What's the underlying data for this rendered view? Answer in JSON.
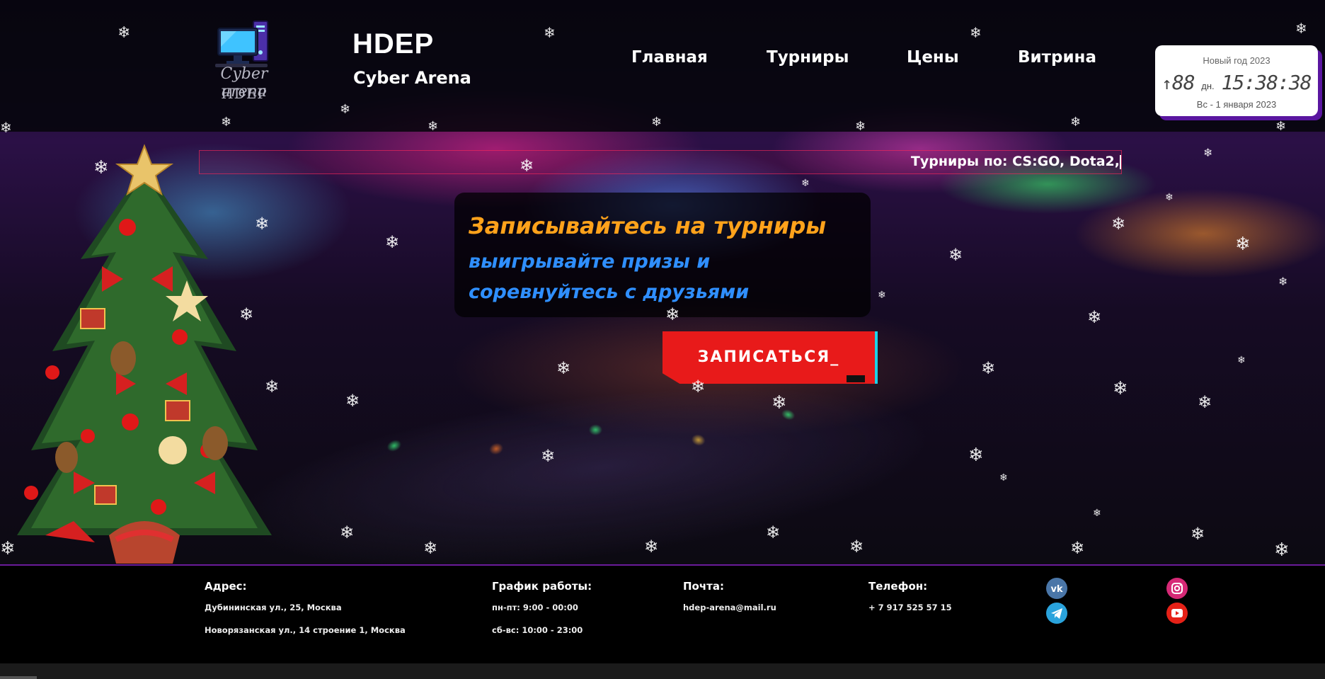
{
  "header": {
    "logo_line1": "Cyber arena",
    "logo_line2": "HDEP",
    "brand_title": "HDEP",
    "brand_subtitle": "Cyber Arena",
    "nav": [
      {
        "label": "Главная"
      },
      {
        "label": "Турниры"
      },
      {
        "label": "Цены"
      },
      {
        "label": "Витрина"
      }
    ]
  },
  "countdown": {
    "title": "Новый год 2023",
    "arrow": "↑",
    "days": "88",
    "days_unit": "дн.",
    "time": "15:38:38",
    "date": "Вс - 1 января 2023"
  },
  "ticker": {
    "text": "Турниры по: CS:GO, Dota2,"
  },
  "promo": {
    "line1": "Записывайтесь на турниры",
    "line2": "выигрывайте призы и соревнуйтесь с друзьями"
  },
  "cta": {
    "label": "ЗАПИСАТЬСЯ_"
  },
  "footer": {
    "address": {
      "heading": "Адрес:",
      "lines": [
        "Дубининская ул., 25, Москва",
        "Новорязанская ул., 14 строение 1, Москва"
      ]
    },
    "schedule": {
      "heading": "График работы:",
      "lines": [
        "пн-пт: 9:00 - 00:00",
        "сб-вс: 10:00 - 23:00"
      ]
    },
    "mail": {
      "heading": "Почта:",
      "value": "hdep-arena@mail.ru"
    },
    "phone": {
      "heading": "Телефон:",
      "value": "+ 7 917 525 57 15"
    },
    "socials": [
      {
        "icon": "vk-icon",
        "color": "#4a76a8"
      },
      {
        "icon": "telegram-icon",
        "color": "#2aa3dc"
      },
      {
        "icon": "instagram-icon",
        "color": "#d62976"
      },
      {
        "icon": "youtube-icon",
        "color": "#e62117"
      }
    ]
  },
  "colors": {
    "accent_orange": "#ffa21b",
    "accent_blue": "#2f8fff",
    "cta_red": "#e81a1a",
    "footer_border": "#6a1b9a"
  }
}
